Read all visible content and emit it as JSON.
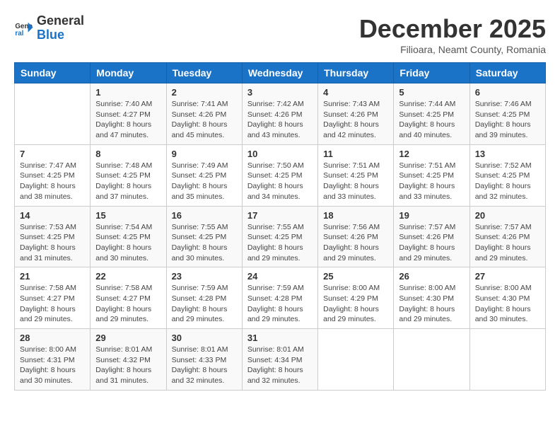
{
  "header": {
    "logo_general": "General",
    "logo_blue": "Blue",
    "month_title": "December 2025",
    "location": "Filioara, Neamt County, Romania"
  },
  "weekdays": [
    "Sunday",
    "Monday",
    "Tuesday",
    "Wednesday",
    "Thursday",
    "Friday",
    "Saturday"
  ],
  "weeks": [
    [
      {
        "day": "",
        "info": ""
      },
      {
        "day": "1",
        "info": "Sunrise: 7:40 AM\nSunset: 4:27 PM\nDaylight: 8 hours\nand 47 minutes."
      },
      {
        "day": "2",
        "info": "Sunrise: 7:41 AM\nSunset: 4:26 PM\nDaylight: 8 hours\nand 45 minutes."
      },
      {
        "day": "3",
        "info": "Sunrise: 7:42 AM\nSunset: 4:26 PM\nDaylight: 8 hours\nand 43 minutes."
      },
      {
        "day": "4",
        "info": "Sunrise: 7:43 AM\nSunset: 4:26 PM\nDaylight: 8 hours\nand 42 minutes."
      },
      {
        "day": "5",
        "info": "Sunrise: 7:44 AM\nSunset: 4:25 PM\nDaylight: 8 hours\nand 40 minutes."
      },
      {
        "day": "6",
        "info": "Sunrise: 7:46 AM\nSunset: 4:25 PM\nDaylight: 8 hours\nand 39 minutes."
      }
    ],
    [
      {
        "day": "7",
        "info": "Sunrise: 7:47 AM\nSunset: 4:25 PM\nDaylight: 8 hours\nand 38 minutes."
      },
      {
        "day": "8",
        "info": "Sunrise: 7:48 AM\nSunset: 4:25 PM\nDaylight: 8 hours\nand 37 minutes."
      },
      {
        "day": "9",
        "info": "Sunrise: 7:49 AM\nSunset: 4:25 PM\nDaylight: 8 hours\nand 35 minutes."
      },
      {
        "day": "10",
        "info": "Sunrise: 7:50 AM\nSunset: 4:25 PM\nDaylight: 8 hours\nand 34 minutes."
      },
      {
        "day": "11",
        "info": "Sunrise: 7:51 AM\nSunset: 4:25 PM\nDaylight: 8 hours\nand 33 minutes."
      },
      {
        "day": "12",
        "info": "Sunrise: 7:51 AM\nSunset: 4:25 PM\nDaylight: 8 hours\nand 33 minutes."
      },
      {
        "day": "13",
        "info": "Sunrise: 7:52 AM\nSunset: 4:25 PM\nDaylight: 8 hours\nand 32 minutes."
      }
    ],
    [
      {
        "day": "14",
        "info": "Sunrise: 7:53 AM\nSunset: 4:25 PM\nDaylight: 8 hours\nand 31 minutes."
      },
      {
        "day": "15",
        "info": "Sunrise: 7:54 AM\nSunset: 4:25 PM\nDaylight: 8 hours\nand 30 minutes."
      },
      {
        "day": "16",
        "info": "Sunrise: 7:55 AM\nSunset: 4:25 PM\nDaylight: 8 hours\nand 30 minutes."
      },
      {
        "day": "17",
        "info": "Sunrise: 7:55 AM\nSunset: 4:25 PM\nDaylight: 8 hours\nand 29 minutes."
      },
      {
        "day": "18",
        "info": "Sunrise: 7:56 AM\nSunset: 4:26 PM\nDaylight: 8 hours\nand 29 minutes."
      },
      {
        "day": "19",
        "info": "Sunrise: 7:57 AM\nSunset: 4:26 PM\nDaylight: 8 hours\nand 29 minutes."
      },
      {
        "day": "20",
        "info": "Sunrise: 7:57 AM\nSunset: 4:26 PM\nDaylight: 8 hours\nand 29 minutes."
      }
    ],
    [
      {
        "day": "21",
        "info": "Sunrise: 7:58 AM\nSunset: 4:27 PM\nDaylight: 8 hours\nand 29 minutes."
      },
      {
        "day": "22",
        "info": "Sunrise: 7:58 AM\nSunset: 4:27 PM\nDaylight: 8 hours\nand 29 minutes."
      },
      {
        "day": "23",
        "info": "Sunrise: 7:59 AM\nSunset: 4:28 PM\nDaylight: 8 hours\nand 29 minutes."
      },
      {
        "day": "24",
        "info": "Sunrise: 7:59 AM\nSunset: 4:28 PM\nDaylight: 8 hours\nand 29 minutes."
      },
      {
        "day": "25",
        "info": "Sunrise: 8:00 AM\nSunset: 4:29 PM\nDaylight: 8 hours\nand 29 minutes."
      },
      {
        "day": "26",
        "info": "Sunrise: 8:00 AM\nSunset: 4:30 PM\nDaylight: 8 hours\nand 29 minutes."
      },
      {
        "day": "27",
        "info": "Sunrise: 8:00 AM\nSunset: 4:30 PM\nDaylight: 8 hours\nand 30 minutes."
      }
    ],
    [
      {
        "day": "28",
        "info": "Sunrise: 8:00 AM\nSunset: 4:31 PM\nDaylight: 8 hours\nand 30 minutes."
      },
      {
        "day": "29",
        "info": "Sunrise: 8:01 AM\nSunset: 4:32 PM\nDaylight: 8 hours\nand 31 minutes."
      },
      {
        "day": "30",
        "info": "Sunrise: 8:01 AM\nSunset: 4:33 PM\nDaylight: 8 hours\nand 32 minutes."
      },
      {
        "day": "31",
        "info": "Sunrise: 8:01 AM\nSunset: 4:34 PM\nDaylight: 8 hours\nand 32 minutes."
      },
      {
        "day": "",
        "info": ""
      },
      {
        "day": "",
        "info": ""
      },
      {
        "day": "",
        "info": ""
      }
    ]
  ]
}
